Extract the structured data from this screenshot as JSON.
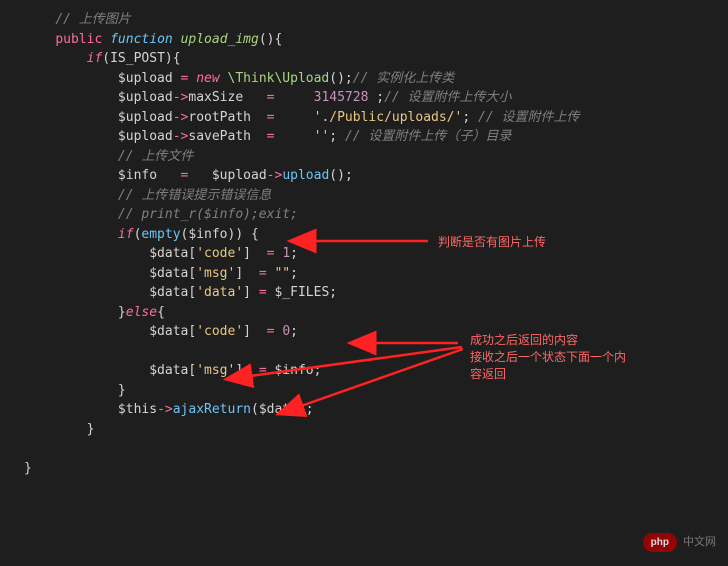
{
  "code": {
    "l1_comment": "// 上传图片",
    "l2_public": "public",
    "l2_function": "function",
    "l2_fname": "upload_img",
    "l3_if": "if",
    "l3_const": "IS_POST",
    "l4_var": "$upload",
    "l4_new": "new",
    "l4_class": "\\Think\\Upload",
    "l4_comment": "// 实例化上传类",
    "l5_var": "$upload",
    "l5_prop": "maxSize",
    "l5_val": "3145728",
    "l5_comment": "// 设置附件上传大小",
    "l6_var": "$upload",
    "l6_prop": "rootPath",
    "l6_val": "'./Public/uploads/'",
    "l6_comment": "// 设置附件上传",
    "l7_var": "$upload",
    "l7_prop": "savePath",
    "l7_val": "''",
    "l7_comment": "// 设置附件上传（子）目录",
    "l8_comment": "// 上传文件",
    "l9_var": "$info",
    "l9_upload": "$upload",
    "l9_method": "upload",
    "l10_comment": "// 上传错误提示错误信息",
    "l11_comment": "// print_r($info);exit;",
    "l12_if": "if",
    "l12_empty": "empty",
    "l12_info": "$info",
    "l13_data": "$data",
    "l13_key": "'code'",
    "l13_val": "1",
    "l14_data": "$data",
    "l14_key": "'msg'",
    "l14_val": "\"\"",
    "l15_data": "$data",
    "l15_key": "'data'",
    "l15_files": "$_FILES",
    "l16_else": "else",
    "l17_data": "$data",
    "l17_key": "'code'",
    "l17_val": "0",
    "l18_data": "$data",
    "l18_key": "'msg'",
    "l18_info": "$info",
    "l19_this": "$this",
    "l19_method": "ajaxReturn",
    "l19_arg": "$data"
  },
  "annotations": {
    "a1": "判断是否有图片上传",
    "a2_l1": "成功之后返回的内容",
    "a2_l2": "接收之后一个状态下面一个内",
    "a2_l3": "容返回"
  },
  "watermark": {
    "badge": "php",
    "text": "中文网"
  }
}
